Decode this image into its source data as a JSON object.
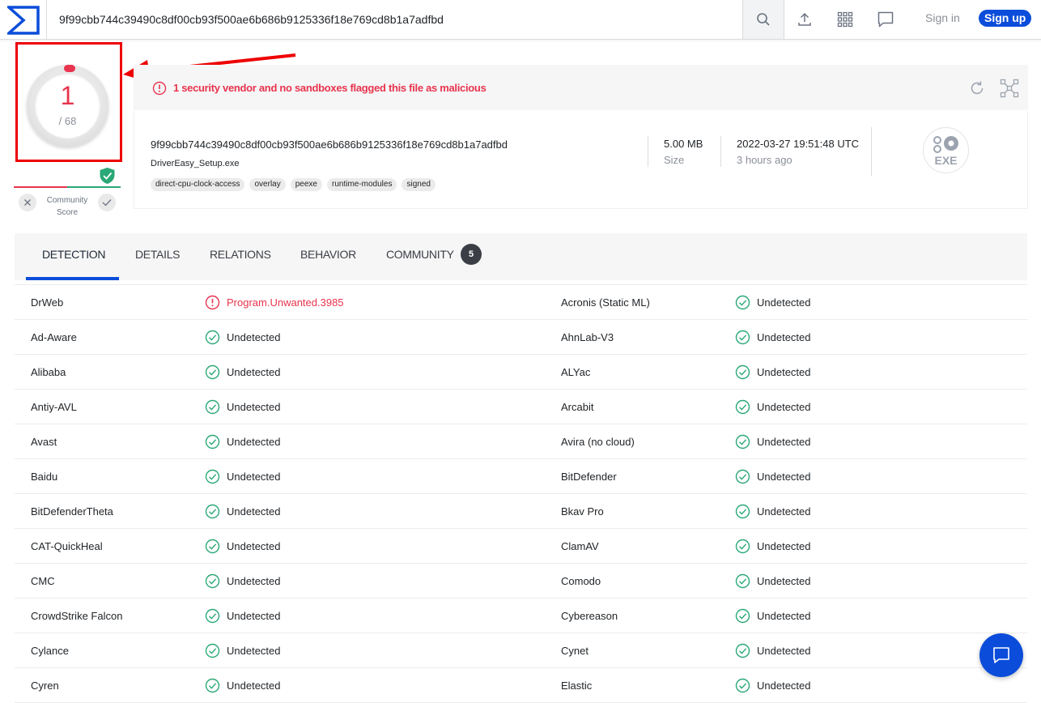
{
  "search": {
    "value": "9f99cbb744c39490c8df00cb93f500ae6b686b9125336f18e769cd8b1a7adfbd"
  },
  "header": {
    "signin_label": "Sign in",
    "signup_label": "Sign up"
  },
  "score": {
    "positives": "1",
    "total": "/ 68",
    "community_label_line1": "Community",
    "community_label_line2": "Score"
  },
  "alert": {
    "message": "1 security vendor and no sandboxes flagged this file as malicious"
  },
  "file": {
    "hash": "9f99cbb744c39490c8df00cb93f500ae6b686b9125336f18e769cd8b1a7adfbd",
    "name": "DriverEasy_Setup.exe",
    "tags": [
      "direct-cpu-clock-access",
      "overlay",
      "peexe",
      "runtime-modules",
      "signed"
    ],
    "size_value": "5.00 MB",
    "size_label": "Size",
    "date_value": "2022-03-27 19:51:48 UTC",
    "date_label": "3 hours ago",
    "type_label": "EXE"
  },
  "tabs": [
    {
      "label": "DETECTION"
    },
    {
      "label": "DETAILS"
    },
    {
      "label": "RELATIONS"
    },
    {
      "label": "BEHAVIOR"
    },
    {
      "label": "COMMUNITY"
    }
  ],
  "community_count": "5",
  "colors": {
    "accent": "#0b4dda",
    "malicious": "#e8344e",
    "clean": "#2aa876"
  },
  "detections": [
    {
      "engine": "DrWeb",
      "result": "Program.Unwanted.3985",
      "status": "malicious",
      "engine2": "Acronis (Static ML)",
      "result2": "Undetected",
      "status2": "clean"
    },
    {
      "engine": "Ad-Aware",
      "result": "Undetected",
      "status": "clean",
      "engine2": "AhnLab-V3",
      "result2": "Undetected",
      "status2": "clean"
    },
    {
      "engine": "Alibaba",
      "result": "Undetected",
      "status": "clean",
      "engine2": "ALYac",
      "result2": "Undetected",
      "status2": "clean"
    },
    {
      "engine": "Antiy-AVL",
      "result": "Undetected",
      "status": "clean",
      "engine2": "Arcabit",
      "result2": "Undetected",
      "status2": "clean"
    },
    {
      "engine": "Avast",
      "result": "Undetected",
      "status": "clean",
      "engine2": "Avira (no cloud)",
      "result2": "Undetected",
      "status2": "clean"
    },
    {
      "engine": "Baidu",
      "result": "Undetected",
      "status": "clean",
      "engine2": "BitDefender",
      "result2": "Undetected",
      "status2": "clean"
    },
    {
      "engine": "BitDefenderTheta",
      "result": "Undetected",
      "status": "clean",
      "engine2": "Bkav Pro",
      "result2": "Undetected",
      "status2": "clean"
    },
    {
      "engine": "CAT-QuickHeal",
      "result": "Undetected",
      "status": "clean",
      "engine2": "ClamAV",
      "result2": "Undetected",
      "status2": "clean"
    },
    {
      "engine": "CMC",
      "result": "Undetected",
      "status": "clean",
      "engine2": "Comodo",
      "result2": "Undetected",
      "status2": "clean"
    },
    {
      "engine": "CrowdStrike Falcon",
      "result": "Undetected",
      "status": "clean",
      "engine2": "Cybereason",
      "result2": "Undetected",
      "status2": "clean"
    },
    {
      "engine": "Cylance",
      "result": "Undetected",
      "status": "clean",
      "engine2": "Cynet",
      "result2": "Undetected",
      "status2": "clean"
    },
    {
      "engine": "Cyren",
      "result": "Undetected",
      "status": "clean",
      "engine2": "Elastic",
      "result2": "Undetected",
      "status2": "clean"
    }
  ]
}
